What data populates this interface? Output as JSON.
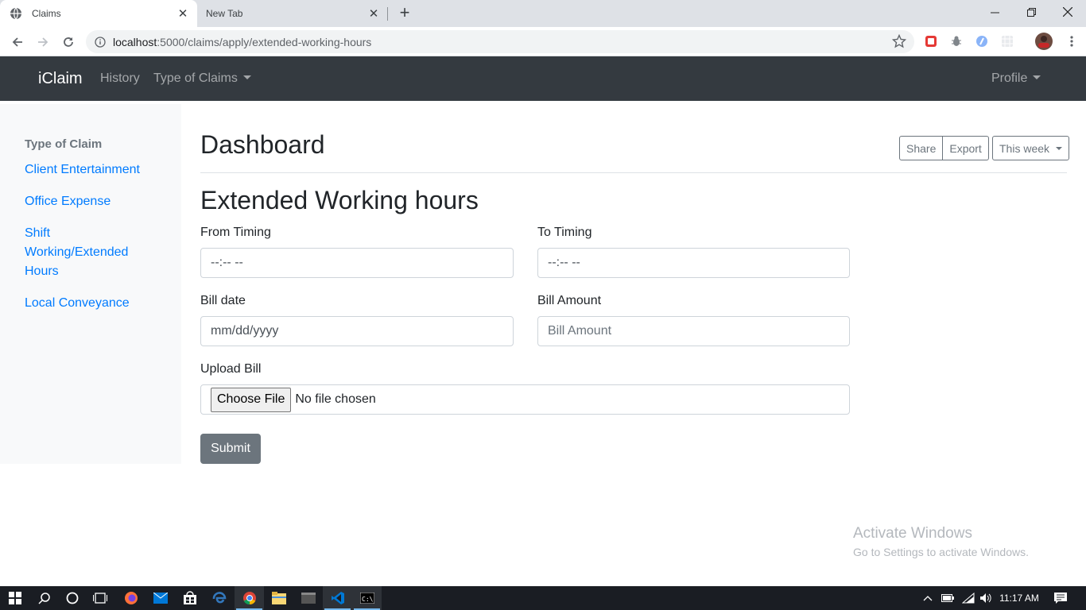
{
  "browser": {
    "tabs": [
      {
        "title": "Claims",
        "active": true
      },
      {
        "title": "New Tab",
        "active": false
      }
    ],
    "url_host": "localhost",
    "url_rest": ":5000/claims/apply/extended-working-hours"
  },
  "navbar": {
    "brand": "iClaim",
    "history": "History",
    "type_of_claims": "Type of Claims",
    "profile": "Profile"
  },
  "sidebar": {
    "heading": "Type of Claim",
    "items": [
      {
        "label": "Client Entertainment"
      },
      {
        "label": "Office Expense"
      },
      {
        "label": "Shift Working/Extended Hours"
      },
      {
        "label": "Local Conveyance"
      }
    ]
  },
  "header": {
    "title": "Dashboard",
    "share": "Share",
    "export": "Export",
    "range": "This week"
  },
  "form": {
    "title": "Extended Working hours",
    "from_label": "From Timing",
    "from_value": "--:-- --",
    "to_label": "To Timing",
    "to_value": "--:-- --",
    "bill_date_label": "Bill date",
    "bill_date_value": "mm/dd/yyyy",
    "bill_amount_label": "Bill Amount",
    "bill_amount_placeholder": "Bill Amount",
    "upload_label": "Upload Bill",
    "choose_file": "Choose File",
    "file_status": "No file chosen",
    "submit": "Submit"
  },
  "watermark": {
    "line1": "Activate Windows",
    "line2": "Go to Settings to activate Windows."
  },
  "taskbar": {
    "time": "11:17 AM"
  },
  "colors": {
    "navbar_bg": "#343a40",
    "link": "#007bff",
    "secondary": "#6c757d",
    "sidebar_bg": "#f8f9fa"
  }
}
